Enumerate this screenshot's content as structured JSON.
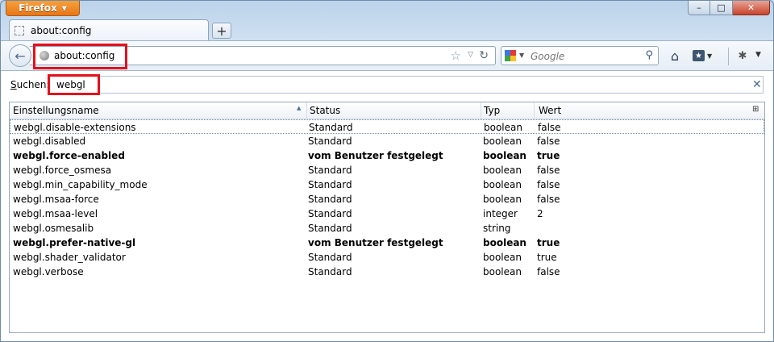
{
  "window": {
    "app_button": "Firefox",
    "controls": {
      "minimize": "–",
      "maximize": "□",
      "close": "✕"
    }
  },
  "tabs": [
    {
      "label": "about:config"
    }
  ],
  "new_tab": "+",
  "navbar": {
    "url": "about:config",
    "search_placeholder": "Google",
    "home_icon": "home-icon",
    "bookmarks_icon": "bookmarks-menu-icon",
    "addon_icon": "addon-icon"
  },
  "filter": {
    "label_prefix": "S",
    "label_rest": "uchen:",
    "value": "webgl"
  },
  "table": {
    "columns": [
      "Einstellungsname",
      "Status",
      "Typ",
      "Wert"
    ],
    "rows": [
      {
        "name": "webgl.disable-extensions",
        "status": "Standard",
        "type": "boolean",
        "value": "false",
        "bold": false
      },
      {
        "name": "webgl.disabled",
        "status": "Standard",
        "type": "boolean",
        "value": "false",
        "bold": false
      },
      {
        "name": "webgl.force-enabled",
        "status": "vom Benutzer festgelegt",
        "type": "boolean",
        "value": "true",
        "bold": true
      },
      {
        "name": "webgl.force_osmesa",
        "status": "Standard",
        "type": "boolean",
        "value": "false",
        "bold": false
      },
      {
        "name": "webgl.min_capability_mode",
        "status": "Standard",
        "type": "boolean",
        "value": "false",
        "bold": false
      },
      {
        "name": "webgl.msaa-force",
        "status": "Standard",
        "type": "boolean",
        "value": "false",
        "bold": false
      },
      {
        "name": "webgl.msaa-level",
        "status": "Standard",
        "type": "integer",
        "value": "2",
        "bold": false
      },
      {
        "name": "webgl.osmesalib",
        "status": "Standard",
        "type": "string",
        "value": "",
        "bold": false
      },
      {
        "name": "webgl.prefer-native-gl",
        "status": "vom Benutzer festgelegt",
        "type": "boolean",
        "value": "true",
        "bold": true
      },
      {
        "name": "webgl.shader_validator",
        "status": "Standard",
        "type": "boolean",
        "value": "true",
        "bold": false
      },
      {
        "name": "webgl.verbose",
        "status": "Standard",
        "type": "boolean",
        "value": "false",
        "bold": false
      }
    ]
  },
  "colors": {
    "highlight": "#e3101d",
    "firefox_orange": "#e6761a"
  }
}
